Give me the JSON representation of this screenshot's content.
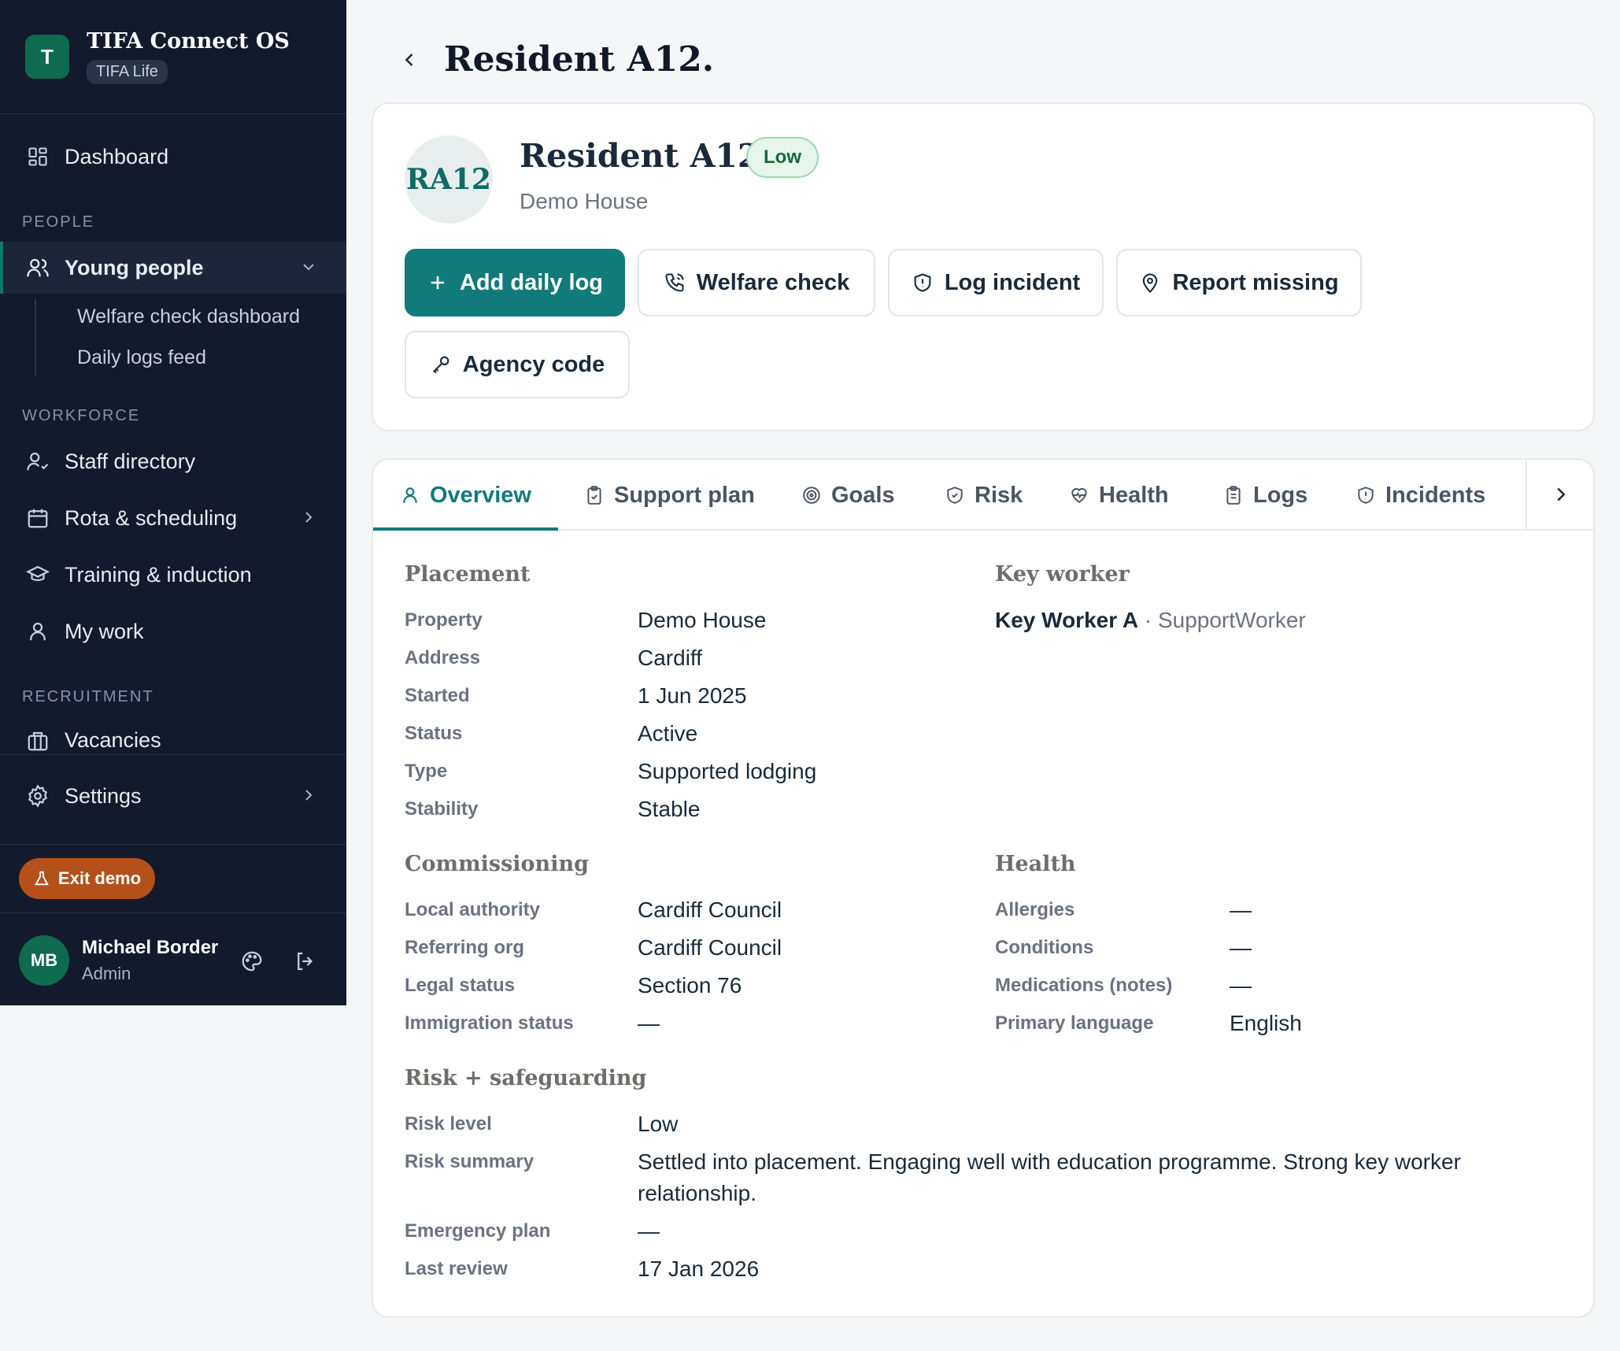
{
  "app": {
    "title": "TIFA Connect OS",
    "badge": "TIFA Life",
    "logo_letter": "T"
  },
  "nav": {
    "dashboard": "Dashboard",
    "section_people": "PEOPLE",
    "young_people": "Young people",
    "sub_welfare": "Welfare check dashboard",
    "sub_daily_logs": "Daily logs feed",
    "section_workforce": "WORKFORCE",
    "staff_directory": "Staff directory",
    "rota": "Rota & scheduling",
    "training": "Training & induction",
    "my_work": "My work",
    "section_recruitment": "RECRUITMENT",
    "vacancies": "Vacancies",
    "settings": "Settings"
  },
  "exit_demo": "Exit demo",
  "user": {
    "initials": "MB",
    "name": "Michael Border",
    "role": "Admin"
  },
  "page": {
    "title": "Resident A12."
  },
  "profile": {
    "initials": "RA12",
    "name": "Resident A12.",
    "risk": "Low",
    "house": "Demo House",
    "actions": {
      "add_daily_log": "Add daily log",
      "welfare_check": "Welfare check",
      "log_incident": "Log incident",
      "report_missing": "Report missing",
      "agency_code": "Agency code"
    }
  },
  "tabs": [
    "Overview",
    "Support plan",
    "Goals",
    "Risk",
    "Health",
    "Logs",
    "Incidents"
  ],
  "placement": {
    "title": "Placement",
    "rows": [
      {
        "label": "Property",
        "value": "Demo House"
      },
      {
        "label": "Address",
        "value": "Cardiff"
      },
      {
        "label": "Started",
        "value": "1 Jun 2025"
      },
      {
        "label": "Status",
        "value": "Active"
      },
      {
        "label": "Type",
        "value": "Supported lodging"
      },
      {
        "label": "Stability",
        "value": "Stable"
      }
    ]
  },
  "key_worker": {
    "title": "Key worker",
    "name": "Key Worker A",
    "role": "· SupportWorker"
  },
  "commissioning": {
    "title": "Commissioning",
    "rows": [
      {
        "label": "Local authority",
        "value": "Cardiff Council"
      },
      {
        "label": "Referring org",
        "value": "Cardiff Council"
      },
      {
        "label": "Legal status",
        "value": "Section 76"
      },
      {
        "label": "Immigration status",
        "value": "—"
      }
    ]
  },
  "health": {
    "title": "Health",
    "rows": [
      {
        "label": "Allergies",
        "value": "—"
      },
      {
        "label": "Conditions",
        "value": "—"
      },
      {
        "label": "Medications (notes)",
        "value": "—"
      },
      {
        "label": "Primary language",
        "value": "English"
      }
    ]
  },
  "risk": {
    "title": "Risk + safeguarding",
    "rows": [
      {
        "label": "Risk level",
        "value": "Low"
      },
      {
        "label": "Risk summary",
        "value": "Settled into placement. Engaging well with education programme. Strong key worker relationship."
      },
      {
        "label": "Emergency plan",
        "value": "—"
      },
      {
        "label": "Last review",
        "value": "17 Jan 2026"
      }
    ]
  }
}
